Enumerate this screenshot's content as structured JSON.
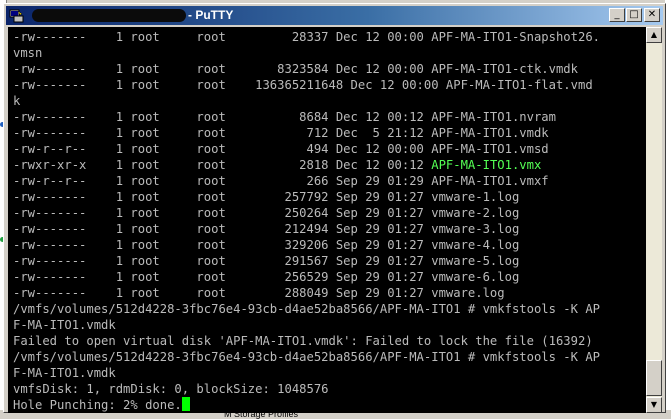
{
  "window": {
    "title": "- PuTTY",
    "buttons": {
      "minimize": "_",
      "maximize": "□",
      "close": "✕"
    }
  },
  "desktop": {
    "bottom_label": "M Storage Profiles"
  },
  "terminal": {
    "cursor_color": "#00ff00",
    "highlight_color": "#54ff54",
    "lines": [
      "-rw-------    1 root     root         28337 Dec 12 00:00 APF-MA-ITO1-Snapshot26.",
      "vmsn",
      "-rw-------    1 root     root       8323584 Dec 12 00:00 APF-MA-ITO1-ctk.vmdk",
      "-rw-------    1 root     root    136365211648 Dec 12 00:00 APF-MA-ITO1-flat.vmd",
      "k",
      "-rw-------    1 root     root          8684 Dec 12 00:12 APF-MA-ITO1.nvram",
      "-rw-------    1 root     root           712 Dec  5 21:12 APF-MA-ITO1.vmdk",
      "-rw-r--r--    1 root     root           494 Dec 12 00:00 APF-MA-ITO1.vmsd",
      "-rwxr-xr-x    1 root     root          2818 Dec 12 00:12 ",
      "-rw-r--r--    1 root     root           266 Sep 29 01:29 APF-MA-ITO1.vmxf",
      "-rw-------    1 root     root        257792 Sep 29 01:27 vmware-1.log",
      "-rw-------    1 root     root        250264 Sep 29 01:27 vmware-2.log",
      "-rw-------    1 root     root        212494 Sep 29 01:27 vmware-3.log",
      "-rw-------    1 root     root        329206 Sep 29 01:27 vmware-4.log",
      "-rw-------    1 root     root        291567 Sep 29 01:27 vmware-5.log",
      "-rw-------    1 root     root        256529 Sep 29 01:27 vmware-6.log",
      "-rw-------    1 root     root        288049 Sep 29 01:27 vmware.log",
      "/vmfs/volumes/512d4228-3fbc76e4-93cb-d4ae52ba8566/APF-MA-ITO1 # vmkfstools -K AP",
      "F-MA-ITO1.vmdk",
      "Failed to open virtual disk 'APF-MA-ITO1.vmdk': Failed to lock the file (16392)",
      "/vmfs/volumes/512d4228-3fbc76e4-93cb-d4ae52ba8566/APF-MA-ITO1 # vmkfstools -K AP",
      "F-MA-ITO1.vmdk",
      "vmfsDisk: 1, rdmDisk: 0, blockSize: 1048576",
      "Hole Punching: 2% done."
    ],
    "vmx_filename": "APF-MA-ITO1.vmx"
  }
}
